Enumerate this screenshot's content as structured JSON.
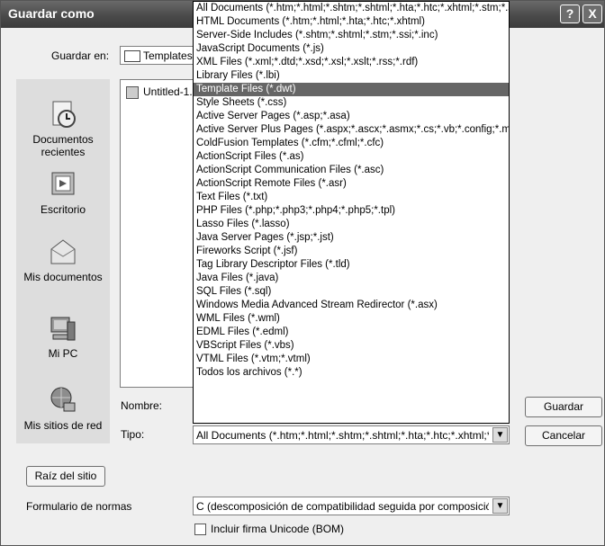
{
  "window": {
    "title": "Guardar como",
    "help_label": "?",
    "close_label": "X"
  },
  "lookin": {
    "label": "Guardar en:",
    "value": "Templates"
  },
  "places": [
    {
      "label": "Documentos recientes",
      "icon": "recent-documents-icon"
    },
    {
      "label": "Escritorio",
      "icon": "desktop-icon"
    },
    {
      "label": "Mis documentos",
      "icon": "my-documents-icon"
    },
    {
      "label": "Mi PC",
      "icon": "my-computer-icon"
    },
    {
      "label": "Mis sitios de red",
      "icon": "network-places-icon"
    }
  ],
  "files": [
    {
      "name": "Untitled-1.dwt"
    }
  ],
  "nombre": {
    "label": "Nombre:",
    "value": ""
  },
  "tipo": {
    "label": "Tipo:",
    "value": "All Documents (*.htm;*.html;*.shtm;*.shtml;*.hta;*.htc;*.xhtml;*.stm;*.ssi;*.js;*.xml;*.dtd;*.xsd;*.xsl;*.xslt;*.rss;*.rdf)"
  },
  "buttons": {
    "guardar": "Guardar",
    "cancelar": "Cancelar",
    "raiz": "Raíz del sitio"
  },
  "normas": {
    "label": "Formulario de normas",
    "value": "C (descomposición de compatibilidad seguida por composición canónica)"
  },
  "bom": {
    "label": "Incluir firma Unicode (BOM)",
    "checked": false
  },
  "dropdown": {
    "selected_index": 5,
    "options": [
      "All Documents (*.htm;*.html;*.shtm;*.shtml;*.hta;*.htc;*.xhtml;*.stm;*.ssi;*.js;*.xml;*.dtd;*.xsd;*.xsl;*.xslt;*.rss;*.rdf)",
      "HTML Documents (*.htm;*.html;*.hta;*.htc;*.xhtml)",
      "Server-Side Includes (*.shtm;*.shtml;*.stm;*.ssi;*.inc)",
      "JavaScript Documents (*.js)",
      "XML Files (*.xml;*.dtd;*.xsd;*.xsl;*.xslt;*.rss;*.rdf)",
      "Library Files (*.lbi)",
      "Template Files (*.dwt)",
      "Style Sheets (*.css)",
      "Active Server Pages (*.asp;*.asa)",
      "Active Server Plus Pages (*.aspx;*.ascx;*.asmx;*.cs;*.vb;*.config;*.master)",
      "ColdFusion Templates (*.cfm;*.cfml;*.cfc)",
      "ActionScript Files (*.as)",
      "ActionScript Communication Files (*.asc)",
      "ActionScript Remote Files (*.asr)",
      "Text Files (*.txt)",
      "PHP Files (*.php;*.php3;*.php4;*.php5;*.tpl)",
      "Lasso Files (*.lasso)",
      "Java Server Pages (*.jsp;*.jst)",
      "Fireworks Script (*.jsf)",
      "Tag Library Descriptor Files (*.tld)",
      "Java Files (*.java)",
      "SQL Files (*.sql)",
      "Windows Media Advanced Stream Redirector (*.asx)",
      "WML Files (*.wml)",
      "EDML Files (*.edml)",
      "VBScript Files (*.vbs)",
      "VTML Files (*.vtm;*.vtml)",
      "Todos los archivos (*.*)"
    ]
  }
}
